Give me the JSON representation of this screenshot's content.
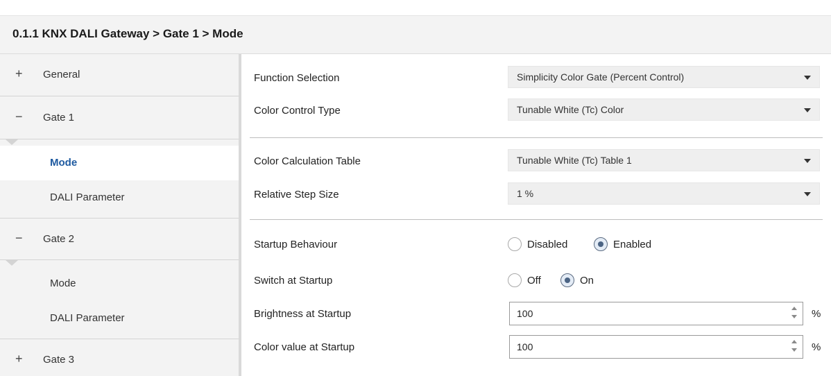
{
  "header": {
    "breadcrumb": "0.1.1 KNX DALI Gateway > Gate 1 > Mode"
  },
  "sidebar": {
    "items": [
      {
        "sign": "+",
        "label": "General"
      },
      {
        "sign": "−",
        "label": "Gate 1"
      },
      {
        "label": "Mode",
        "selected": true
      },
      {
        "label": "DALI Parameter"
      },
      {
        "sign": "−",
        "label": "Gate 2"
      },
      {
        "label": "Mode"
      },
      {
        "label": "DALI Parameter"
      },
      {
        "sign": "+",
        "label": "Gate 3"
      }
    ]
  },
  "params": {
    "function_selection": {
      "label": "Function Selection",
      "value": "Simplicity Color Gate (Percent Control)"
    },
    "color_control_type": {
      "label": "Color Control Type",
      "value": "Tunable White (Tc) Color"
    },
    "color_calc_table": {
      "label": "Color Calculation Table",
      "value": "Tunable White (Tc) Table 1"
    },
    "relative_step_size": {
      "label": "Relative Step Size",
      "value": "1 %"
    },
    "startup_behaviour": {
      "label": "Startup Behaviour",
      "options": [
        "Disabled",
        "Enabled"
      ],
      "selected": "Enabled"
    },
    "switch_at_startup": {
      "label": "Switch at Startup",
      "options": [
        "Off",
        "On"
      ],
      "selected": "On"
    },
    "brightness_at_startup": {
      "label": "Brightness at Startup",
      "value": "100",
      "unit": "%"
    },
    "color_value_at_startup": {
      "label": "Color value at Startup",
      "value": "100",
      "unit": "%"
    }
  },
  "colors": {
    "selected_nav_text": "#1e5aa0",
    "sidebar_bg": "#f3f3f3"
  }
}
